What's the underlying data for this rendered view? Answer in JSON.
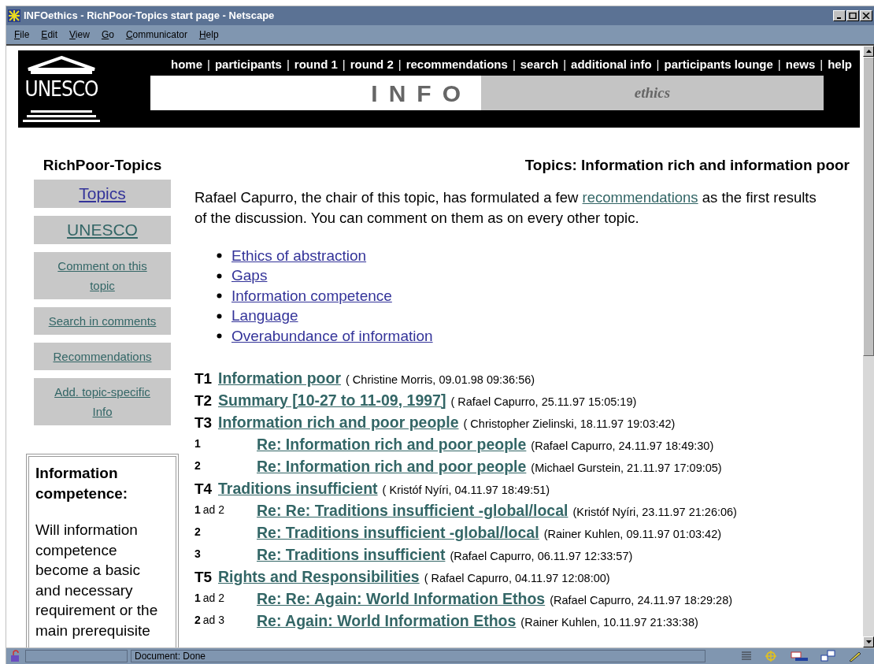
{
  "window": {
    "title": "INFOethics - RichPoor-Topics start page - Netscape"
  },
  "menu": [
    {
      "label": "File"
    },
    {
      "label": "Edit"
    },
    {
      "label": "View"
    },
    {
      "label": "Go"
    },
    {
      "label": "Communicator"
    },
    {
      "label": "Help"
    }
  ],
  "banner": {
    "logo_text": "UNESCO",
    "separator": "|",
    "nav": [
      "home",
      "participants",
      "round 1",
      "round 2",
      "recommendations",
      "search",
      "additional info",
      "participants lounge",
      "news",
      "help"
    ],
    "word": "INFO",
    "subtitle": "ethics"
  },
  "sidebar": {
    "heading": "RichPoor-Topics",
    "links": [
      {
        "label": "Topics",
        "kind": "primary",
        "visited": false
      },
      {
        "label": "UNESCO",
        "kind": "primary",
        "visited": true
      },
      {
        "label": "Comment on this topic",
        "kind": "secondary",
        "visited": true
      },
      {
        "label": "Search in comments",
        "kind": "secondary",
        "visited": true
      },
      {
        "label": "Recommendations",
        "kind": "secondary",
        "visited": true
      },
      {
        "label": "Add. topic-specific Info",
        "kind": "secondary",
        "visited": true
      }
    ],
    "info_box": {
      "title": "Information competence:",
      "body": "Will information competence become a basic and necessary requirement or the main prerequisite"
    }
  },
  "main": {
    "title": "Topics: Information rich and information poor",
    "intro": {
      "before": "Rafael Capurro, the chair of this topic, has formulated a few",
      "link": "recommendations",
      "link_visited": true,
      "after": "as the first results of the discussion. You can comment on them as on every other topic."
    },
    "bullets": [
      {
        "label": "Ethics of abstraction",
        "visited": false
      },
      {
        "label": "Gaps",
        "visited": false
      },
      {
        "label": "Information competence",
        "visited": false
      },
      {
        "label": "Language",
        "visited": false
      },
      {
        "label": "Overabundance of information",
        "visited": false
      }
    ],
    "threads": [
      {
        "label": "T1",
        "title": "Information poor",
        "meta": "( Christine Morris, 09.01.98 09:36:56)",
        "visited": true
      },
      {
        "label": "T2",
        "title": "Summary [10-27 to 11-09, 1997]",
        "meta": "( Rafael Capurro, 25.11.97 15:05:19)",
        "visited": true
      },
      {
        "label": "T3",
        "title": "Information rich and poor people",
        "meta": "( Christopher Zielinski, 18.11.97 19:03:42)",
        "visited": true,
        "children": [
          {
            "number": "1",
            "title": "Re: Information rich and poor people",
            "meta": "(Rafael Capurro, 24.11.97 18:49:30)",
            "visited": true
          },
          {
            "number": "2",
            "title": "Re: Information rich and poor people",
            "meta": "(Michael Gurstein, 21.11.97 17:09:05)",
            "visited": true
          }
        ]
      },
      {
        "label": "T4",
        "title": "Traditions insufficient",
        "meta": "( Kristóf Nyíri, 04.11.97 18:49:51)",
        "visited": true,
        "children": [
          {
            "number": "1",
            "ad": "ad 2",
            "title": "Re: Re: Traditions insufficient -global/local",
            "meta": "(Kristóf Nyíri, 23.11.97 21:26:06)",
            "visited": true
          },
          {
            "number": "2",
            "title": "Re: Traditions insufficient -global/local",
            "meta": "(Rainer Kuhlen, 09.11.97 01:03:42)",
            "visited": true
          },
          {
            "number": "3",
            "title": "Re: Traditions insufficient",
            "meta": "(Rafael Capurro, 06.11.97 12:33:57)",
            "visited": true
          }
        ]
      },
      {
        "label": "T5",
        "title": "Rights and Responsibilities",
        "meta": "( Rafael Capurro, 04.11.97 12:08:00)",
        "visited": true,
        "children": [
          {
            "number": "1",
            "ad": "ad 2",
            "title": "Re: Re: Again: World Information Ethos",
            "meta": "(Rafael Capurro, 24.11.97 18:29:28)",
            "visited": true
          },
          {
            "number": "2",
            "ad": "ad 3",
            "title": "Re: Again: World Information Ethos",
            "meta": "(Rainer Kuhlen, 10.11.97 21:33:38)",
            "visited": true
          }
        ]
      }
    ]
  },
  "status_bar": {
    "text": "Document: Done"
  }
}
